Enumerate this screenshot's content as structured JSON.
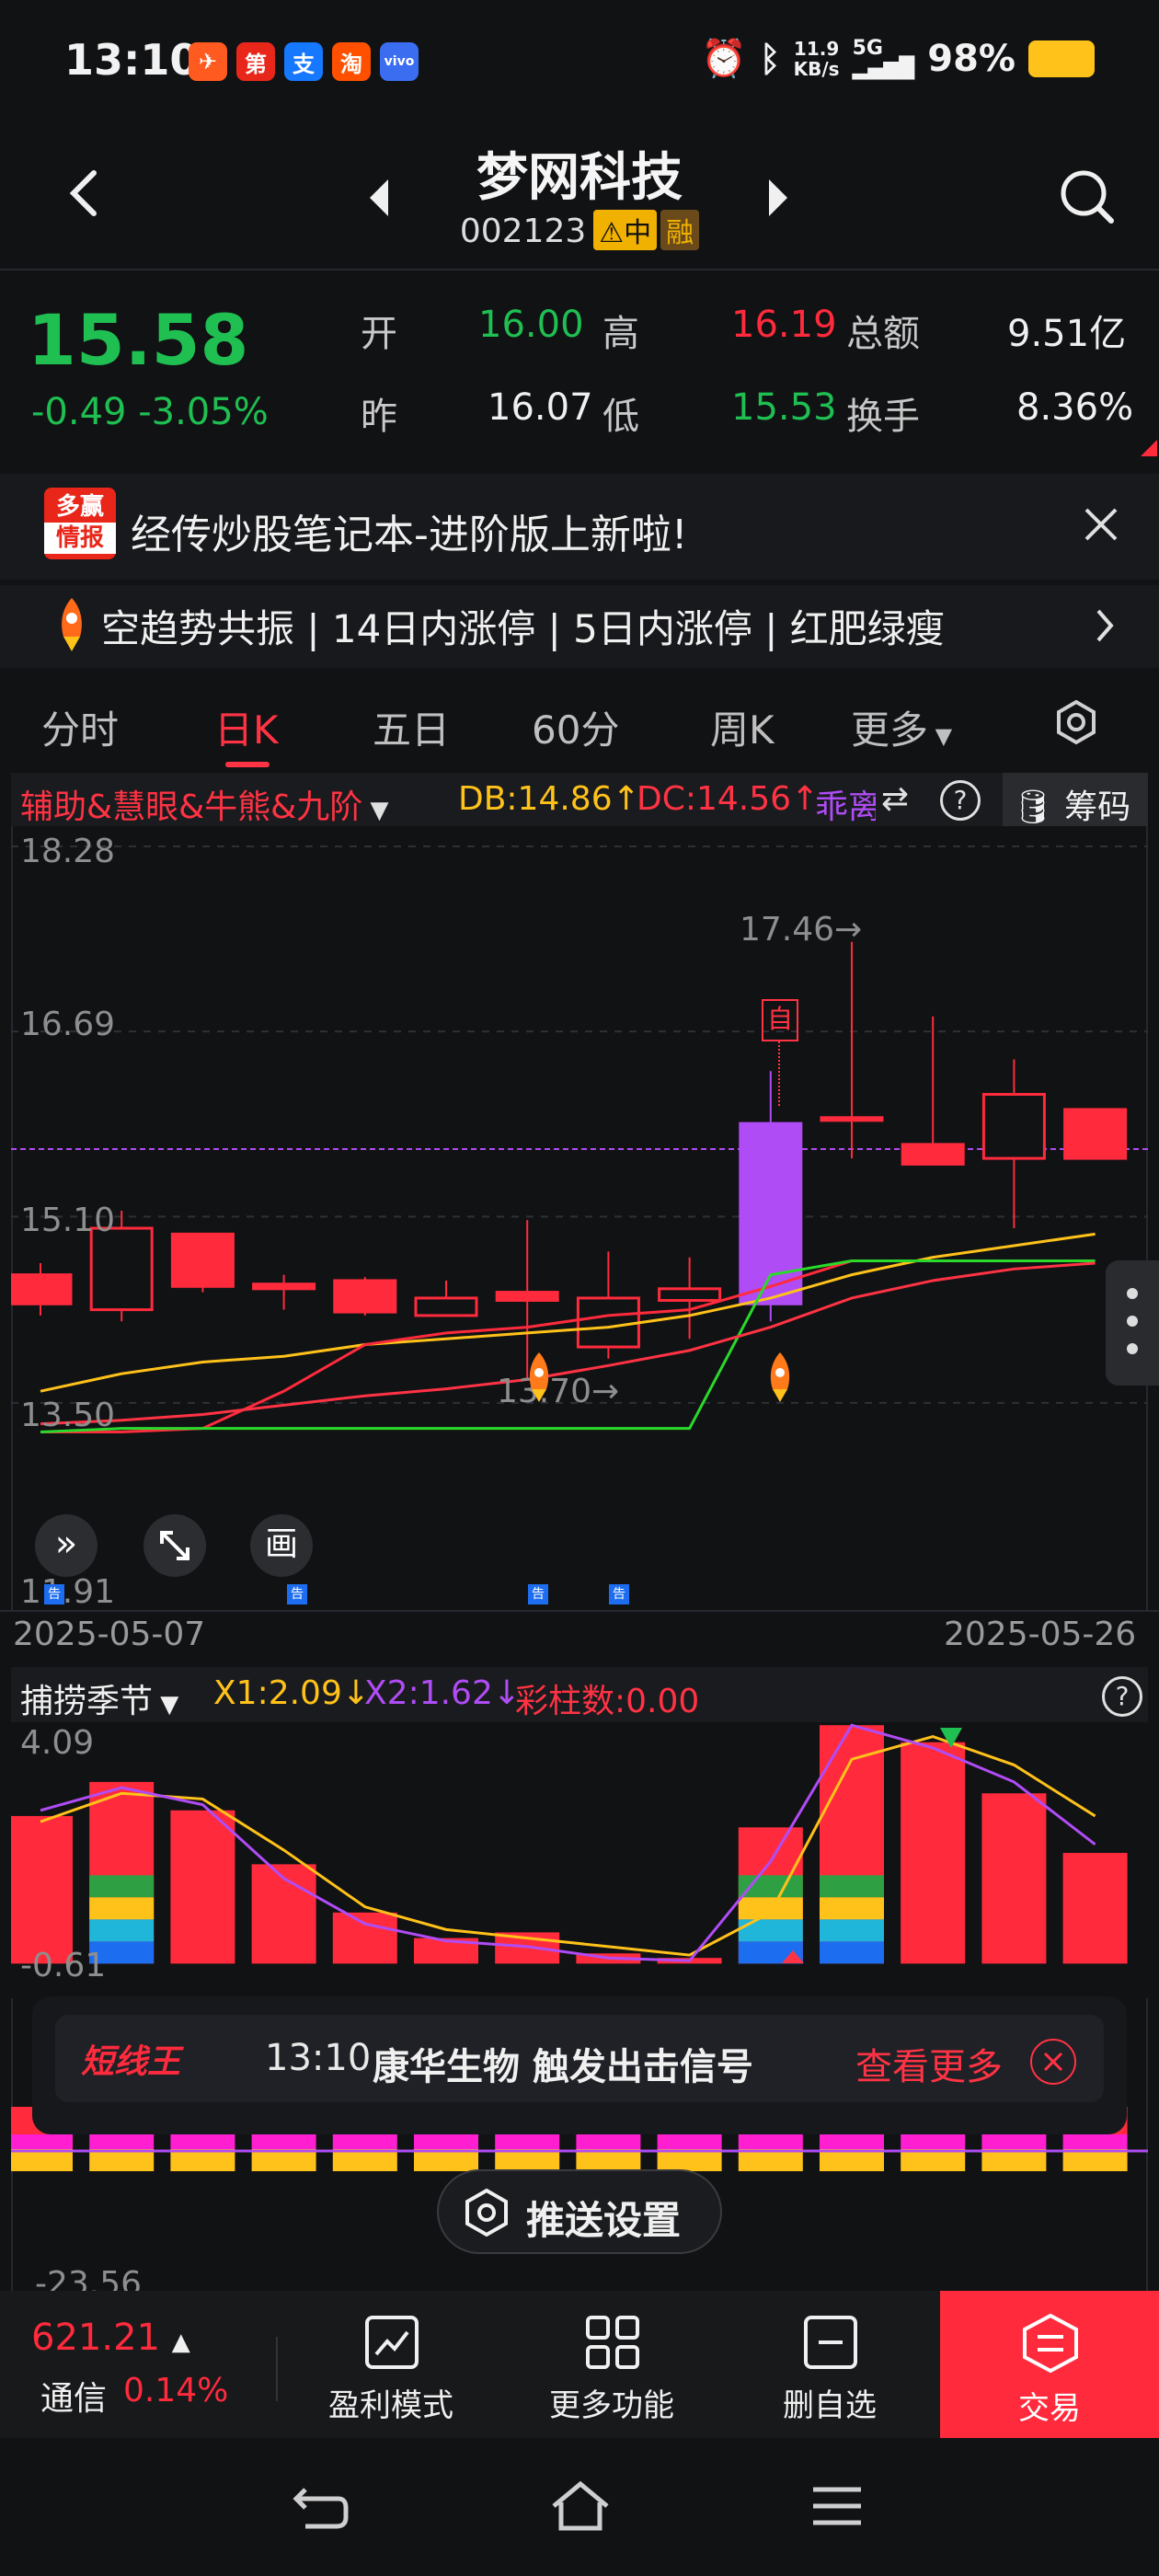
{
  "status_bar": {
    "time": "13:10",
    "apps": [
      "第",
      "支",
      "淘",
      "vivo"
    ],
    "net_speed": "11.9",
    "net_unit": "KB/s",
    "signal": "5G",
    "battery": "98%"
  },
  "header": {
    "stock_name": "梦网科技",
    "stock_code": "002123",
    "tag_zhong": "中",
    "tag_rong": "融"
  },
  "quote": {
    "price": "15.58",
    "change": "-0.49 -3.05%",
    "open_label": "开",
    "open": "16.00",
    "high_label": "高",
    "high": "16.19",
    "amount_label": "总额",
    "amount": "9.51亿",
    "prev_label": "昨",
    "prev": "16.07",
    "low_label": "低",
    "low": "15.53",
    "turnover_label": "换手",
    "turnover": "8.36%"
  },
  "banner": {
    "badge_top": "多赢",
    "badge_bottom": "情报",
    "text": "经传炒股笔记本-进阶版上新啦!"
  },
  "ticker": {
    "text": "空趋势共振 | 14日内涨停 | 5日内涨停 | 红肥绿瘦"
  },
  "tabs": [
    "分时",
    "日K",
    "五日",
    "60分",
    "周K",
    "更多"
  ],
  "indicator_bar": {
    "name": "辅助&慧眼&牛熊&九阶",
    "db": "DB:14.86↑",
    "dc": "DC:14.56↑",
    "extra": "乖离",
    "chips": "筹码"
  },
  "main_chart": {
    "y_ticks": [
      "18.28",
      "16.69",
      "15.10",
      "13.50",
      "11.91"
    ],
    "high_label": "17.46→",
    "low_label": "13.70→",
    "self_tag": "自",
    "date_start": "2025-05-07",
    "date_end": "2025-05-26",
    "gao": "告",
    "draw_btn": "画",
    "candles": [
      {
        "o": 14.35,
        "c": 14.6,
        "h": 14.7,
        "l": 14.25
      },
      {
        "o": 14.3,
        "c": 15.0,
        "h": 15.15,
        "l": 14.2
      },
      {
        "o": 14.5,
        "c": 14.95,
        "h": 14.95,
        "l": 14.45
      },
      {
        "o": 14.48,
        "c": 14.52,
        "h": 14.6,
        "l": 14.3
      },
      {
        "o": 14.28,
        "c": 14.55,
        "h": 14.58,
        "l": 14.25
      },
      {
        "o": 14.25,
        "c": 14.4,
        "h": 14.55,
        "l": 14.25
      },
      {
        "o": 14.38,
        "c": 14.45,
        "h": 15.07,
        "l": 13.7
      },
      {
        "o": 13.98,
        "c": 14.4,
        "h": 14.8,
        "l": 13.88
      },
      {
        "o": 14.38,
        "c": 14.48,
        "h": 14.75,
        "l": 14.05
      },
      {
        "o": 14.35,
        "c": 15.9,
        "h": 16.35,
        "l": 14.2
      },
      {
        "o": 15.95,
        "c": 15.95,
        "h": 17.46,
        "l": 15.6
      },
      {
        "o": 15.55,
        "c": 15.72,
        "h": 16.82,
        "l": 15.55
      },
      {
        "o": 15.6,
        "c": 16.15,
        "h": 16.45,
        "l": 15.0
      },
      {
        "o": 15.6,
        "c": 16.02,
        "h": 16.02,
        "l": 15.6
      }
    ],
    "y_min": 11.91,
    "y_max": 18.28
  },
  "sub_chart": {
    "name": "捕捞季节",
    "x1": "X1:2.09↓",
    "x2": "X2:1.62↓",
    "bars_label": "彩柱数:0.00",
    "y_top": "4.09",
    "y_bottom": "-0.61",
    "values": [
      2.6,
      3.2,
      2.7,
      1.75,
      0.9,
      0.45,
      0.55,
      0.18,
      0.1,
      2.4,
      4.2,
      3.9,
      3.0,
      1.95
    ],
    "y_min": -0.61,
    "y_max": 4.09
  },
  "third_chart": {
    "y_bottom": "-23.56"
  },
  "popup": {
    "brand": "短线王",
    "time": "13:10",
    "message": "康华生物 触发出击信号",
    "action": "查看更多"
  },
  "push_settings": "推送设置",
  "bottom_nav": {
    "index_value": "621.21",
    "index_name": "通信",
    "index_change": "0.14%",
    "items": [
      "盈利模式",
      "更多功能",
      "删自选",
      "交易"
    ]
  },
  "colors": {
    "up": "#ff2b3d",
    "down": "#1fbf52",
    "purple": "#b04cf5",
    "yellow": "#ffc21a"
  }
}
